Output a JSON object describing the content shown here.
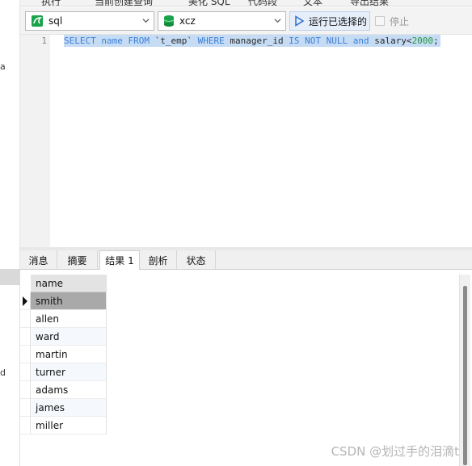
{
  "left_sidebar": {
    "fragments": [
      "a",
      "d"
    ]
  },
  "top_toolbar": {
    "items": [
      "执行",
      "当前创建查询",
      "美化 SQL",
      "代码段",
      "文本",
      "导出结果"
    ]
  },
  "query_toolbar": {
    "connection_selector": {
      "value": "sql",
      "icon": "mysql-connection-icon"
    },
    "database_selector": {
      "value": "xcz",
      "icon": "database-icon"
    },
    "run_selected_label": "运行已选择的",
    "stop_label": "停止"
  },
  "editor": {
    "line_number": "1",
    "tokens": [
      {
        "t": "SELECT",
        "k": "kw"
      },
      {
        "t": " ",
        "k": "id"
      },
      {
        "t": "name",
        "k": "kw"
      },
      {
        "t": " ",
        "k": "id"
      },
      {
        "t": "FROM",
        "k": "kw"
      },
      {
        "t": " `t_emp` ",
        "k": "id"
      },
      {
        "t": "WHERE",
        "k": "kw"
      },
      {
        "t": " manager_id ",
        "k": "id"
      },
      {
        "t": "IS NOT NULL",
        "k": "kw"
      },
      {
        "t": " ",
        "k": "id"
      },
      {
        "t": "and",
        "k": "kw"
      },
      {
        "t": " salary<",
        "k": "id"
      },
      {
        "t": "2000",
        "k": "num"
      },
      {
        "t": ";",
        "k": "id"
      }
    ]
  },
  "result_tabs": [
    {
      "label": "消息",
      "active": false
    },
    {
      "label": "摘要",
      "active": false
    },
    {
      "label": "结果 1",
      "active": true
    },
    {
      "label": "剖析",
      "active": false
    },
    {
      "label": "状态",
      "active": false
    }
  ],
  "result_grid": {
    "column": "name",
    "rows": [
      "smith",
      "allen",
      "ward",
      "martin",
      "turner",
      "adams",
      "james",
      "miller"
    ],
    "selected_row": 0
  },
  "watermark": "CSDN @划过手的泪滴t",
  "colors": {
    "selection": "#c6dcf4",
    "keyword": "#3d7fd6",
    "number": "#1f9a3a",
    "run_icon": "#2a6fd0",
    "db_icon": "#1aa34a",
    "mysql_icon": "#1aa34a"
  }
}
